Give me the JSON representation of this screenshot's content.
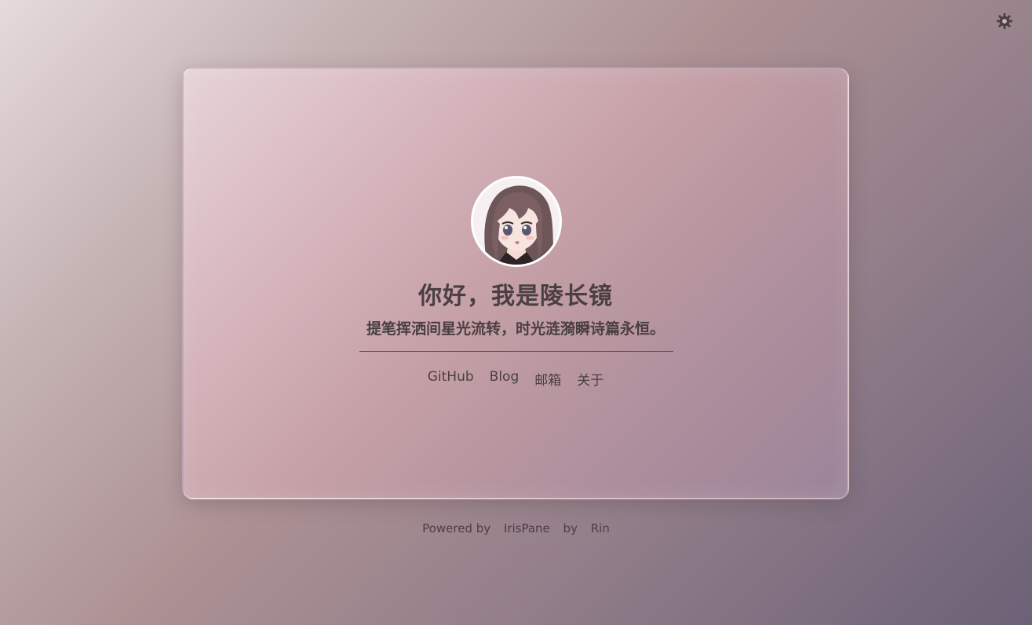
{
  "header": {
    "theme_toggle_icon": "gear-icon"
  },
  "profile": {
    "avatar_icon": "anime-girl-avatar",
    "title": "你好，我是陵长镜",
    "subtitle": "提笔挥洒间星光流转，时光涟漪瞬诗篇永恒。"
  },
  "links": [
    {
      "label": "GitHub"
    },
    {
      "label": "Blog"
    },
    {
      "label": "邮箱"
    },
    {
      "label": "关于"
    }
  ],
  "footer": {
    "powered_by": "Powered by",
    "project": "IrisPane",
    "by": "by",
    "author": "Rin"
  },
  "colors": {
    "text": "#4a3f41",
    "accent_bg_top_left": "#e6dadd",
    "accent_bg_bottom_right": "#6c6177"
  }
}
